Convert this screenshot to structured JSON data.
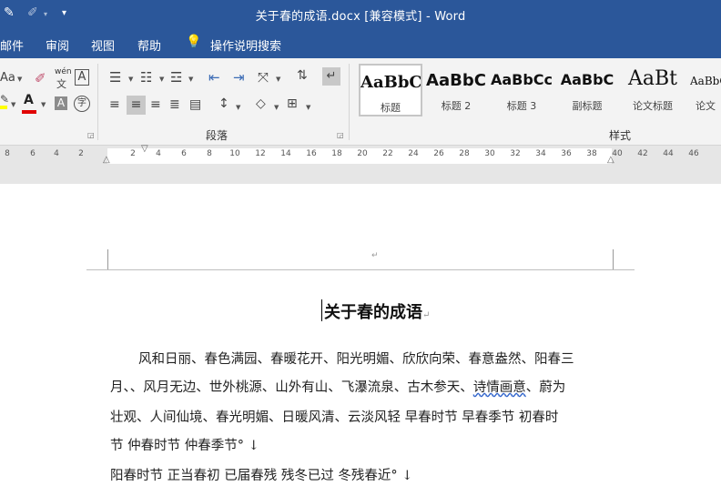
{
  "titlebar": {
    "title": "关于春的成语.docx [兼容模式]  -  Word"
  },
  "menu": {
    "items": [
      "邮件",
      "审阅",
      "视图",
      "帮助"
    ],
    "tell_me": "操作说明搜索"
  },
  "ribbon": {
    "paragraph_group_label": "段落",
    "styles_group_label": "样式",
    "font_size_btn": "Aa",
    "phonetic_top": "wén",
    "phonetic_bottom": "文",
    "border_char": "A",
    "shade_char": "A",
    "enclose_char": "字",
    "styles": [
      {
        "sample": "AaBbC",
        "name": "标题"
      },
      {
        "sample": "AaBbC",
        "name": "标题 2"
      },
      {
        "sample": "AaBbCc",
        "name": "标题 3"
      },
      {
        "sample": "AaBbC",
        "name": "副标题"
      },
      {
        "sample": "AaBt",
        "name": "论文标题"
      },
      {
        "sample": "AaBbC",
        "name": "论文"
      }
    ]
  },
  "ruler": {
    "left_ticks": [
      "8",
      "6",
      "4",
      "2"
    ],
    "right_ticks": [
      "2",
      "4",
      "6",
      "8",
      "10",
      "12",
      "14",
      "16",
      "18",
      "20",
      "22",
      "24",
      "26",
      "28",
      "30",
      "32",
      "34",
      "36",
      "38",
      "40",
      "42",
      "44",
      "46"
    ]
  },
  "document": {
    "header_mark": "↵",
    "title": "关于春的成语",
    "title_mark": "↵",
    "lines": [
      "风和日丽、春色满园、春暖花开、阳光明媚、欣欣向荣、春意盎然、阳春三",
      "月、、风月无边、世外桃源、山外有山、飞瀑流泉、古木参天、",
      "诗情画意",
      "、蔚为",
      "壮观、人间仙境、春光明媚、日暖风清、云淡风轻  早春时节  早春季节  初春时",
      "节  仲春时节  仲春季节°  ↓",
      "阳春时节  正当春初  已届春残  残冬已过  冬残春近°  ↓"
    ]
  },
  "colors": {
    "brand": "#2b579a",
    "ribbon": "#f3f3f3",
    "highlight_yellow": "#ffff00",
    "font_red": "#e00000"
  }
}
